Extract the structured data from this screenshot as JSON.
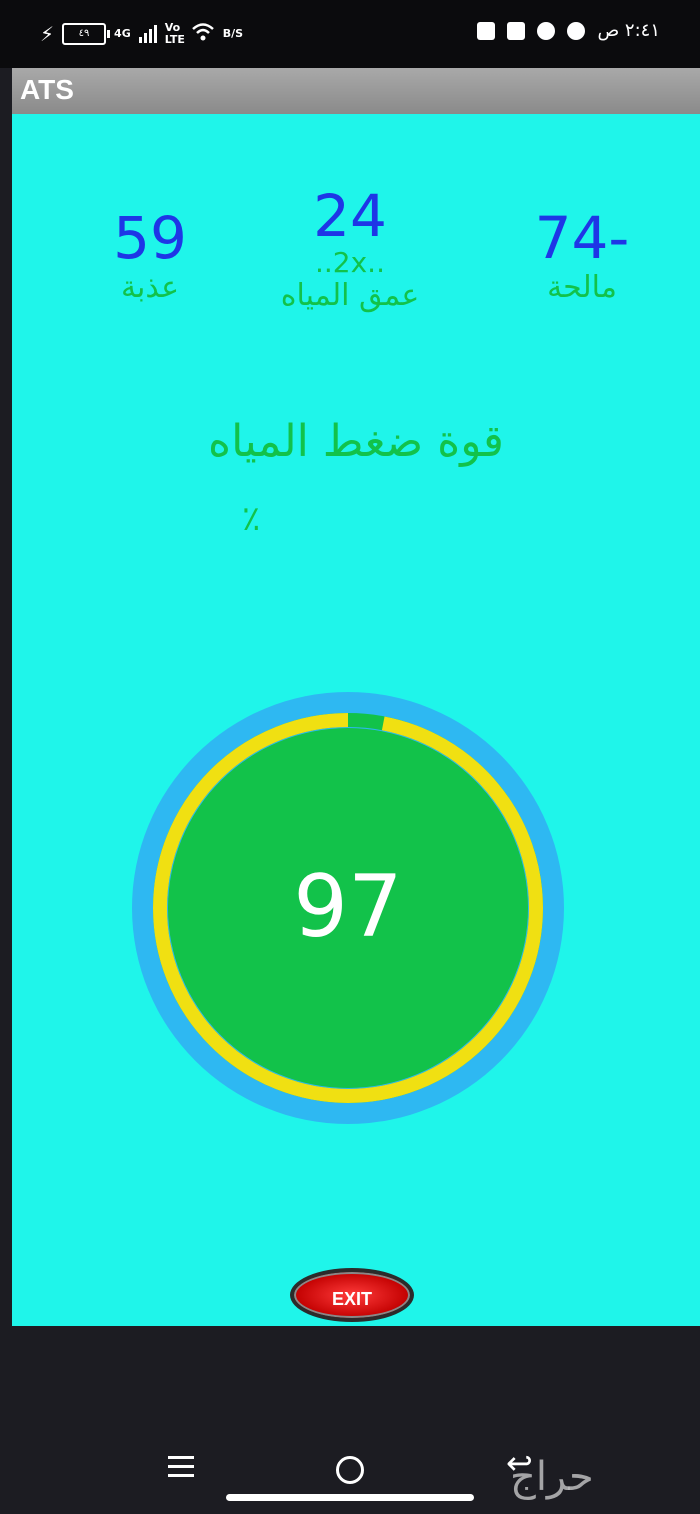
{
  "status_bar": {
    "time": "٢:٤١ ص",
    "battery": "٤٩",
    "network": "4G",
    "volte": "Vo LTE",
    "speed": "B/S"
  },
  "app": {
    "title": "ATS"
  },
  "stats": {
    "fresh": {
      "value": "59",
      "label": "عذبة"
    },
    "depth": {
      "value": "24",
      "multiplier": "..2x..",
      "label": "عمق المياه"
    },
    "salty": {
      "value": "74-",
      "label": "مالحة"
    }
  },
  "pressure": {
    "title": "قوة ضغط المياه",
    "unit": "٪",
    "value": "97",
    "percent": 97,
    "colors": {
      "outer_ring": "#2eb8f2",
      "progress": "#f0e012",
      "track": "#12c24a",
      "face": "#12c24a"
    }
  },
  "exit_label": "EXIT",
  "watermark": "حراج",
  "colors": {
    "background": "#1ff5ea",
    "number": "#1e36e6",
    "label": "#12c24a"
  }
}
